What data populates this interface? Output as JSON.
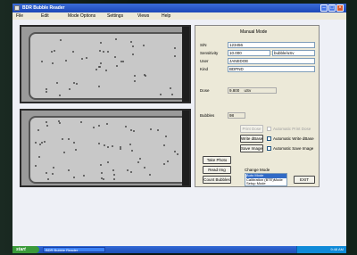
{
  "window": {
    "title": "BDR Bubble Reader"
  },
  "menu": [
    "File",
    "Edit",
    "Mode Options",
    "Settings",
    "Views",
    "Help"
  ],
  "camera_views": [
    {
      "name": "top-detector-view",
      "bubble_dots": 44
    },
    {
      "name": "bottom-detector-view",
      "bubble_dots": 60
    }
  ],
  "panel": {
    "heading": "Manual Mode",
    "sn_label": "S/N",
    "sn_value": "123456",
    "sensitivity_label": "Sensitivity",
    "sensitivity_value": "10.000",
    "sensitivity_unit": "bubble/uSv",
    "user_label": "User",
    "user_value": "JANEDOE",
    "kind_label": "Kind",
    "kind_value": "BDPND",
    "dose_label": "Dose",
    "dose_value": "9.800",
    "dose_unit": "uSv",
    "bubbles_label": "Bubbles",
    "bubbles_value": "98",
    "print_dose": "Print Dose",
    "automatic_print_dose": "Automatic Print Dose",
    "write_dbase": "Write dBase",
    "automatic_write_dbase": "Automatic Write dBase",
    "save_image": "Save Image",
    "automatic_save_image": "Automatic Save Image",
    "take_photo": "Take Photo",
    "read_img": "Read Img",
    "count_bubbles": "Count Bubbles",
    "change_mode_label": "Change Mode",
    "mode_options": [
      "Auto Mode",
      "Calibration (BTE)Mode",
      "Setup Mode"
    ],
    "selected_mode": "Auto Mode",
    "exit": "EXIT"
  },
  "taskbar": {
    "start": "start",
    "task": "BDR Bubble Reader",
    "clock": "9:48 AM"
  }
}
